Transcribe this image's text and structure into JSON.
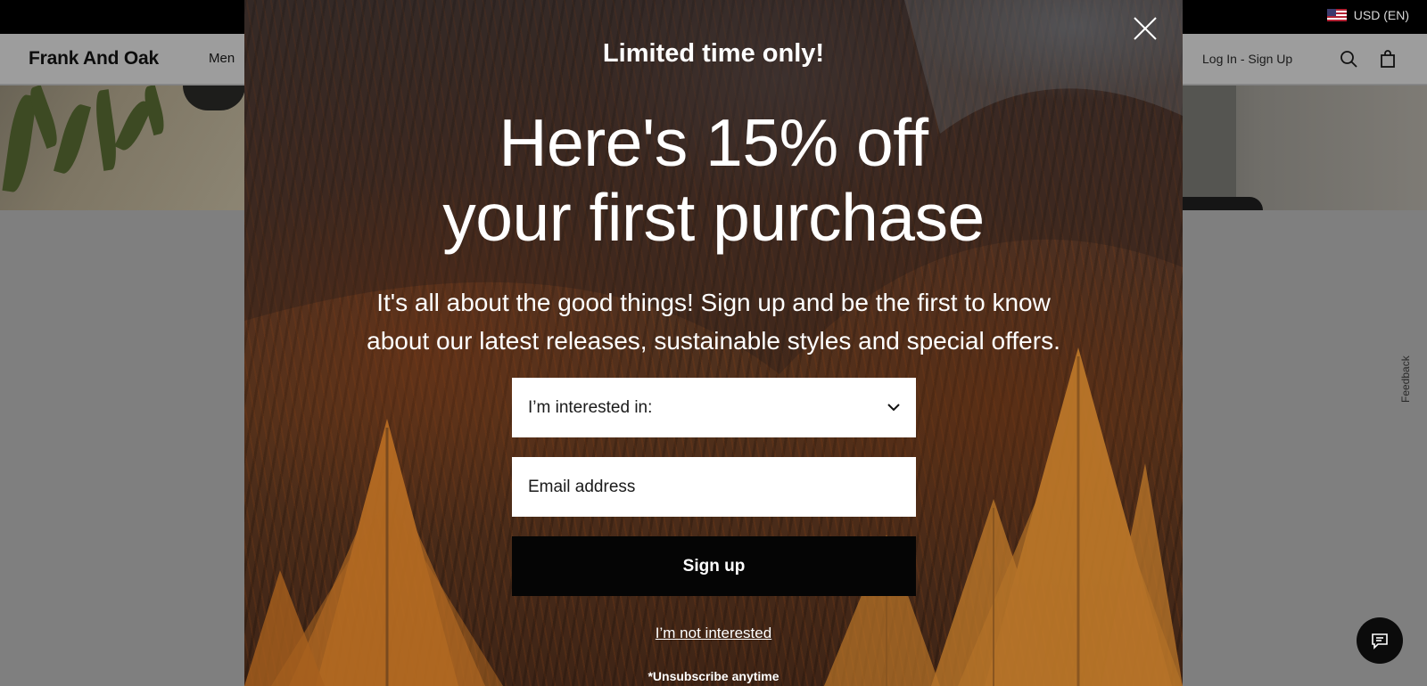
{
  "topbar": {
    "currency_label": "USD (EN)"
  },
  "header": {
    "brand": "Frank And Oak",
    "nav_men": "Men",
    "login_label": "Log In - Sign Up"
  },
  "feedback_tab": {
    "label": "Feedback"
  },
  "popup": {
    "eyebrow": "Limited time only!",
    "headline_line1": "Here's 15% off",
    "headline_line2": "your first purchase",
    "description_line1": "It's all about the good things! Sign up and be the first to know",
    "description_line2": "about our latest releases, sustainable styles and special offers.",
    "interest_select": {
      "value": "I’m interested in:"
    },
    "email_field": {
      "placeholder": "Email address"
    },
    "signup_label": "Sign up",
    "decline_label": "I’m not interested",
    "footnote": "*Unsubscribe anytime"
  },
  "colors": {
    "overlay": "#7f7f7f",
    "button_bg": "#050505",
    "text_on_photo": "#ffffff",
    "autumn_tree": "#c07a2a"
  },
  "icons": [
    "flag-us-icon",
    "search-icon",
    "bag-icon",
    "close-icon",
    "chevron-down-icon",
    "chat-icon"
  ]
}
